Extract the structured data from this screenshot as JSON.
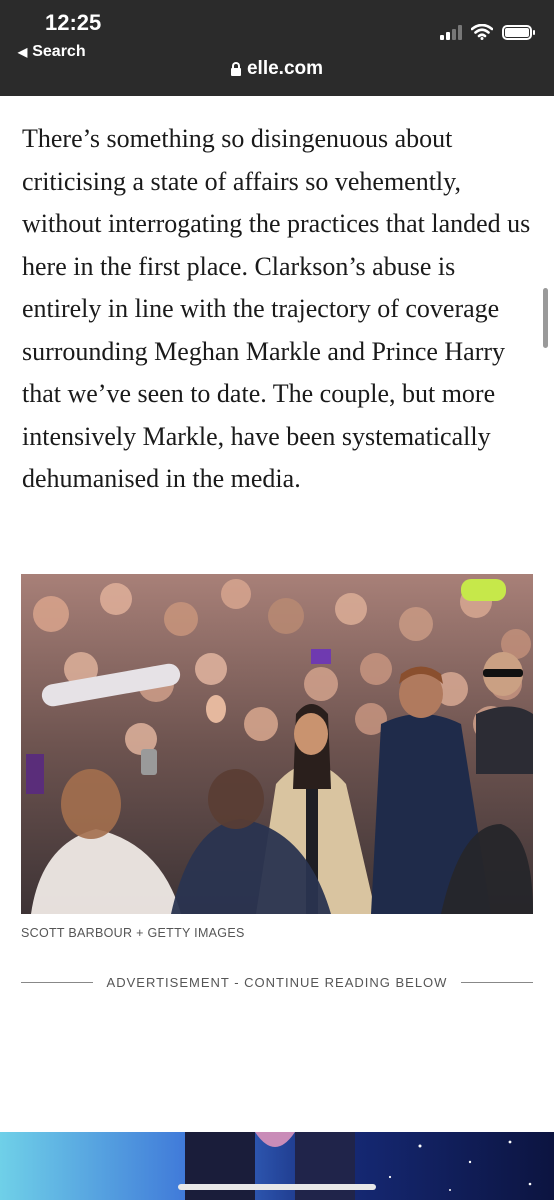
{
  "status_bar": {
    "time": "12:25",
    "back_label": "Search",
    "url": "elle.com"
  },
  "article": {
    "paragraph": "There’s something so disingenuous about criticising a state of affairs so vehemently, without interrogating the practices that landed us here in the first place. Clarkson’s abuse is entirely in line with the trajectory of coverage surrounding Meghan Markle and Prince Harry that we’ve seen to date. The couple, but more intensively Markle, have been systematically dehumanised in the media.",
    "photo_caption": "SCOTT BARBOUR + GETTY IMAGES",
    "ad_label": "ADVERTISEMENT - CONTINUE READING BELOW"
  },
  "icons": {
    "back": "back-triangle-icon",
    "signal": "cellular-signal-icon",
    "wifi": "wifi-icon",
    "battery": "battery-icon",
    "lock": "lock-icon"
  },
  "colors": {
    "topbar_bg": "#2b2b2b",
    "text": "#1a1a1a",
    "caption": "#555555"
  }
}
